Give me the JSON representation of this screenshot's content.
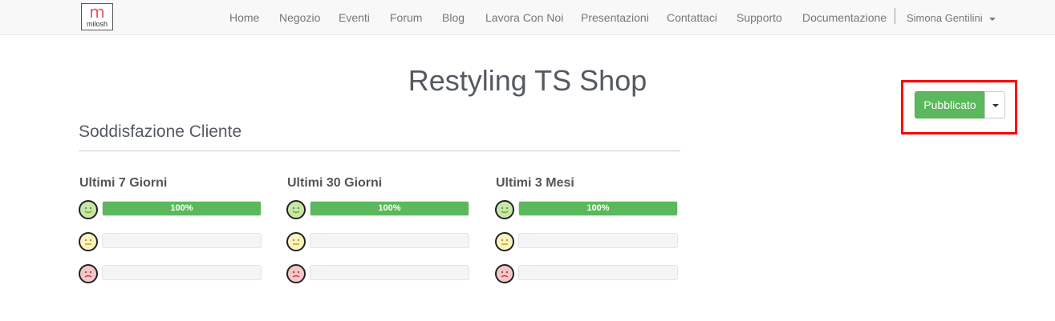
{
  "navbar": {
    "logo_text": "milosh",
    "items": [
      "Home",
      "Negozio",
      "Eventi",
      "Forum",
      "Blog",
      "Lavora Con Noi",
      "Presentazioni",
      "Contattaci",
      "Supporto",
      "Documentazione"
    ],
    "user": "Simona Gentilini"
  },
  "page": {
    "title": "Restyling TS Shop"
  },
  "status": {
    "label": "Pubblicato",
    "accent": "#5cb85c",
    "highlight": "#ff0000"
  },
  "satisfaction": {
    "title": "Soddisfazione Cliente",
    "periods": [
      {
        "label": "Ultimi 7 Giorni",
        "rows": [
          {
            "face": "happy-face-icon",
            "percent": 100,
            "text": "100%"
          },
          {
            "face": "neutral-face-icon",
            "percent": 0,
            "text": "0%"
          },
          {
            "face": "sad-face-icon",
            "percent": 0,
            "text": "0%"
          }
        ]
      },
      {
        "label": "Ultimi 30 Giorni",
        "rows": [
          {
            "face": "happy-face-icon",
            "percent": 100,
            "text": "100%"
          },
          {
            "face": "neutral-face-icon",
            "percent": 0,
            "text": "0%"
          },
          {
            "face": "sad-face-icon",
            "percent": 0,
            "text": "0%"
          }
        ]
      },
      {
        "label": "Ultimi 3 Mesi",
        "rows": [
          {
            "face": "happy-face-icon",
            "percent": 100,
            "text": "100%"
          },
          {
            "face": "neutral-face-icon",
            "percent": 0,
            "text": "0%"
          },
          {
            "face": "sad-face-icon",
            "percent": 0,
            "text": "0%"
          }
        ]
      }
    ]
  }
}
